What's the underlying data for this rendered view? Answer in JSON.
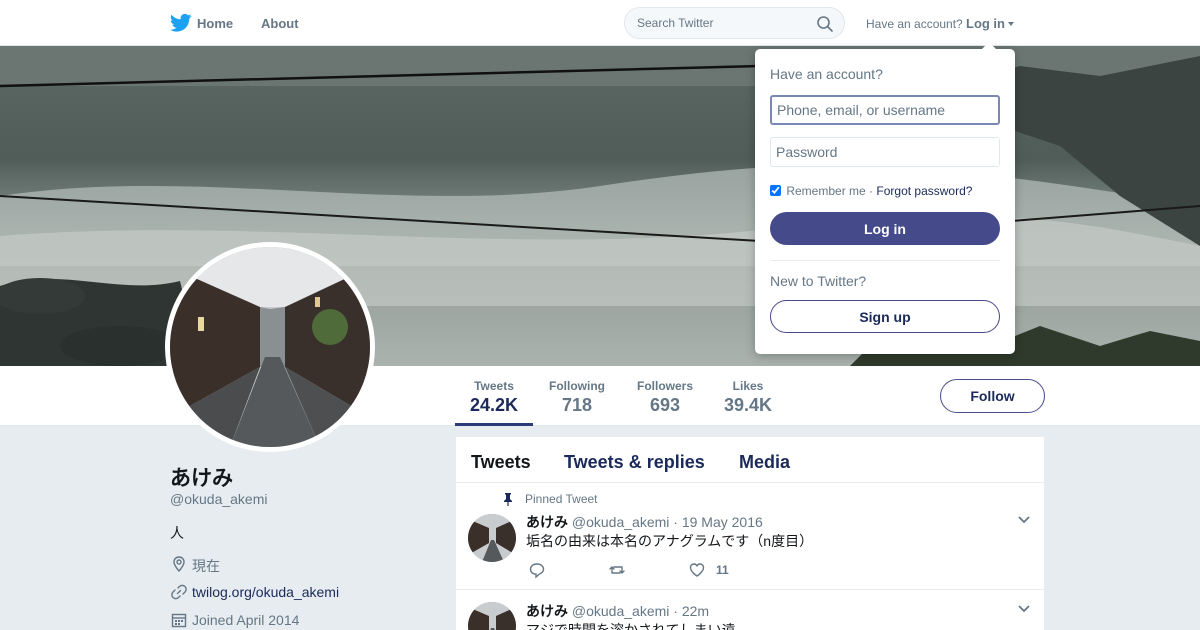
{
  "nav": {
    "home_label": "Home",
    "about_label": "About",
    "search_placeholder": "Search Twitter",
    "have_account": "Have an account?",
    "login_label": "Log in"
  },
  "profile": {
    "name": "あけみ",
    "handle": "@okuda_akemi",
    "bio": "人",
    "location": "現在",
    "url": "twilog.org/okuda_akemi",
    "joined": "Joined April 2014"
  },
  "stats": [
    {
      "label": "Tweets",
      "value": "24.2K",
      "active": true
    },
    {
      "label": "Following",
      "value": "718",
      "active": false
    },
    {
      "label": "Followers",
      "value": "693",
      "active": false
    },
    {
      "label": "Likes",
      "value": "39.4K",
      "active": false
    }
  ],
  "follow_label": "Follow",
  "tabs": [
    "Tweets",
    "Tweets & replies",
    "Media"
  ],
  "tweets": [
    {
      "pinned_label": "Pinned Tweet",
      "name": "あけみ",
      "handle": "@okuda_akemi",
      "time": "· 19 May 2016",
      "text": "垢名の由来は本名のアナグラムです（n度目）",
      "like_count": "11"
    },
    {
      "name": "あけみ",
      "handle": "@okuda_akemi",
      "time": "· 22m",
      "text": "マジで時間を溶かされてしまい遠"
    }
  ],
  "login_dropdown": {
    "title": "Have an account?",
    "username_placeholder": "Phone, email, or username",
    "password_placeholder": "Password",
    "remember_label": "Remember me",
    "separator": "·",
    "forgot_label": "Forgot password?",
    "login_button": "Log in",
    "new_label": "New to Twitter?",
    "signup_button": "Sign up"
  },
  "colors": {
    "accent": "#454a8a",
    "link": "#1b2a5a",
    "muted": "#657786",
    "background": "#e6ecf0"
  }
}
